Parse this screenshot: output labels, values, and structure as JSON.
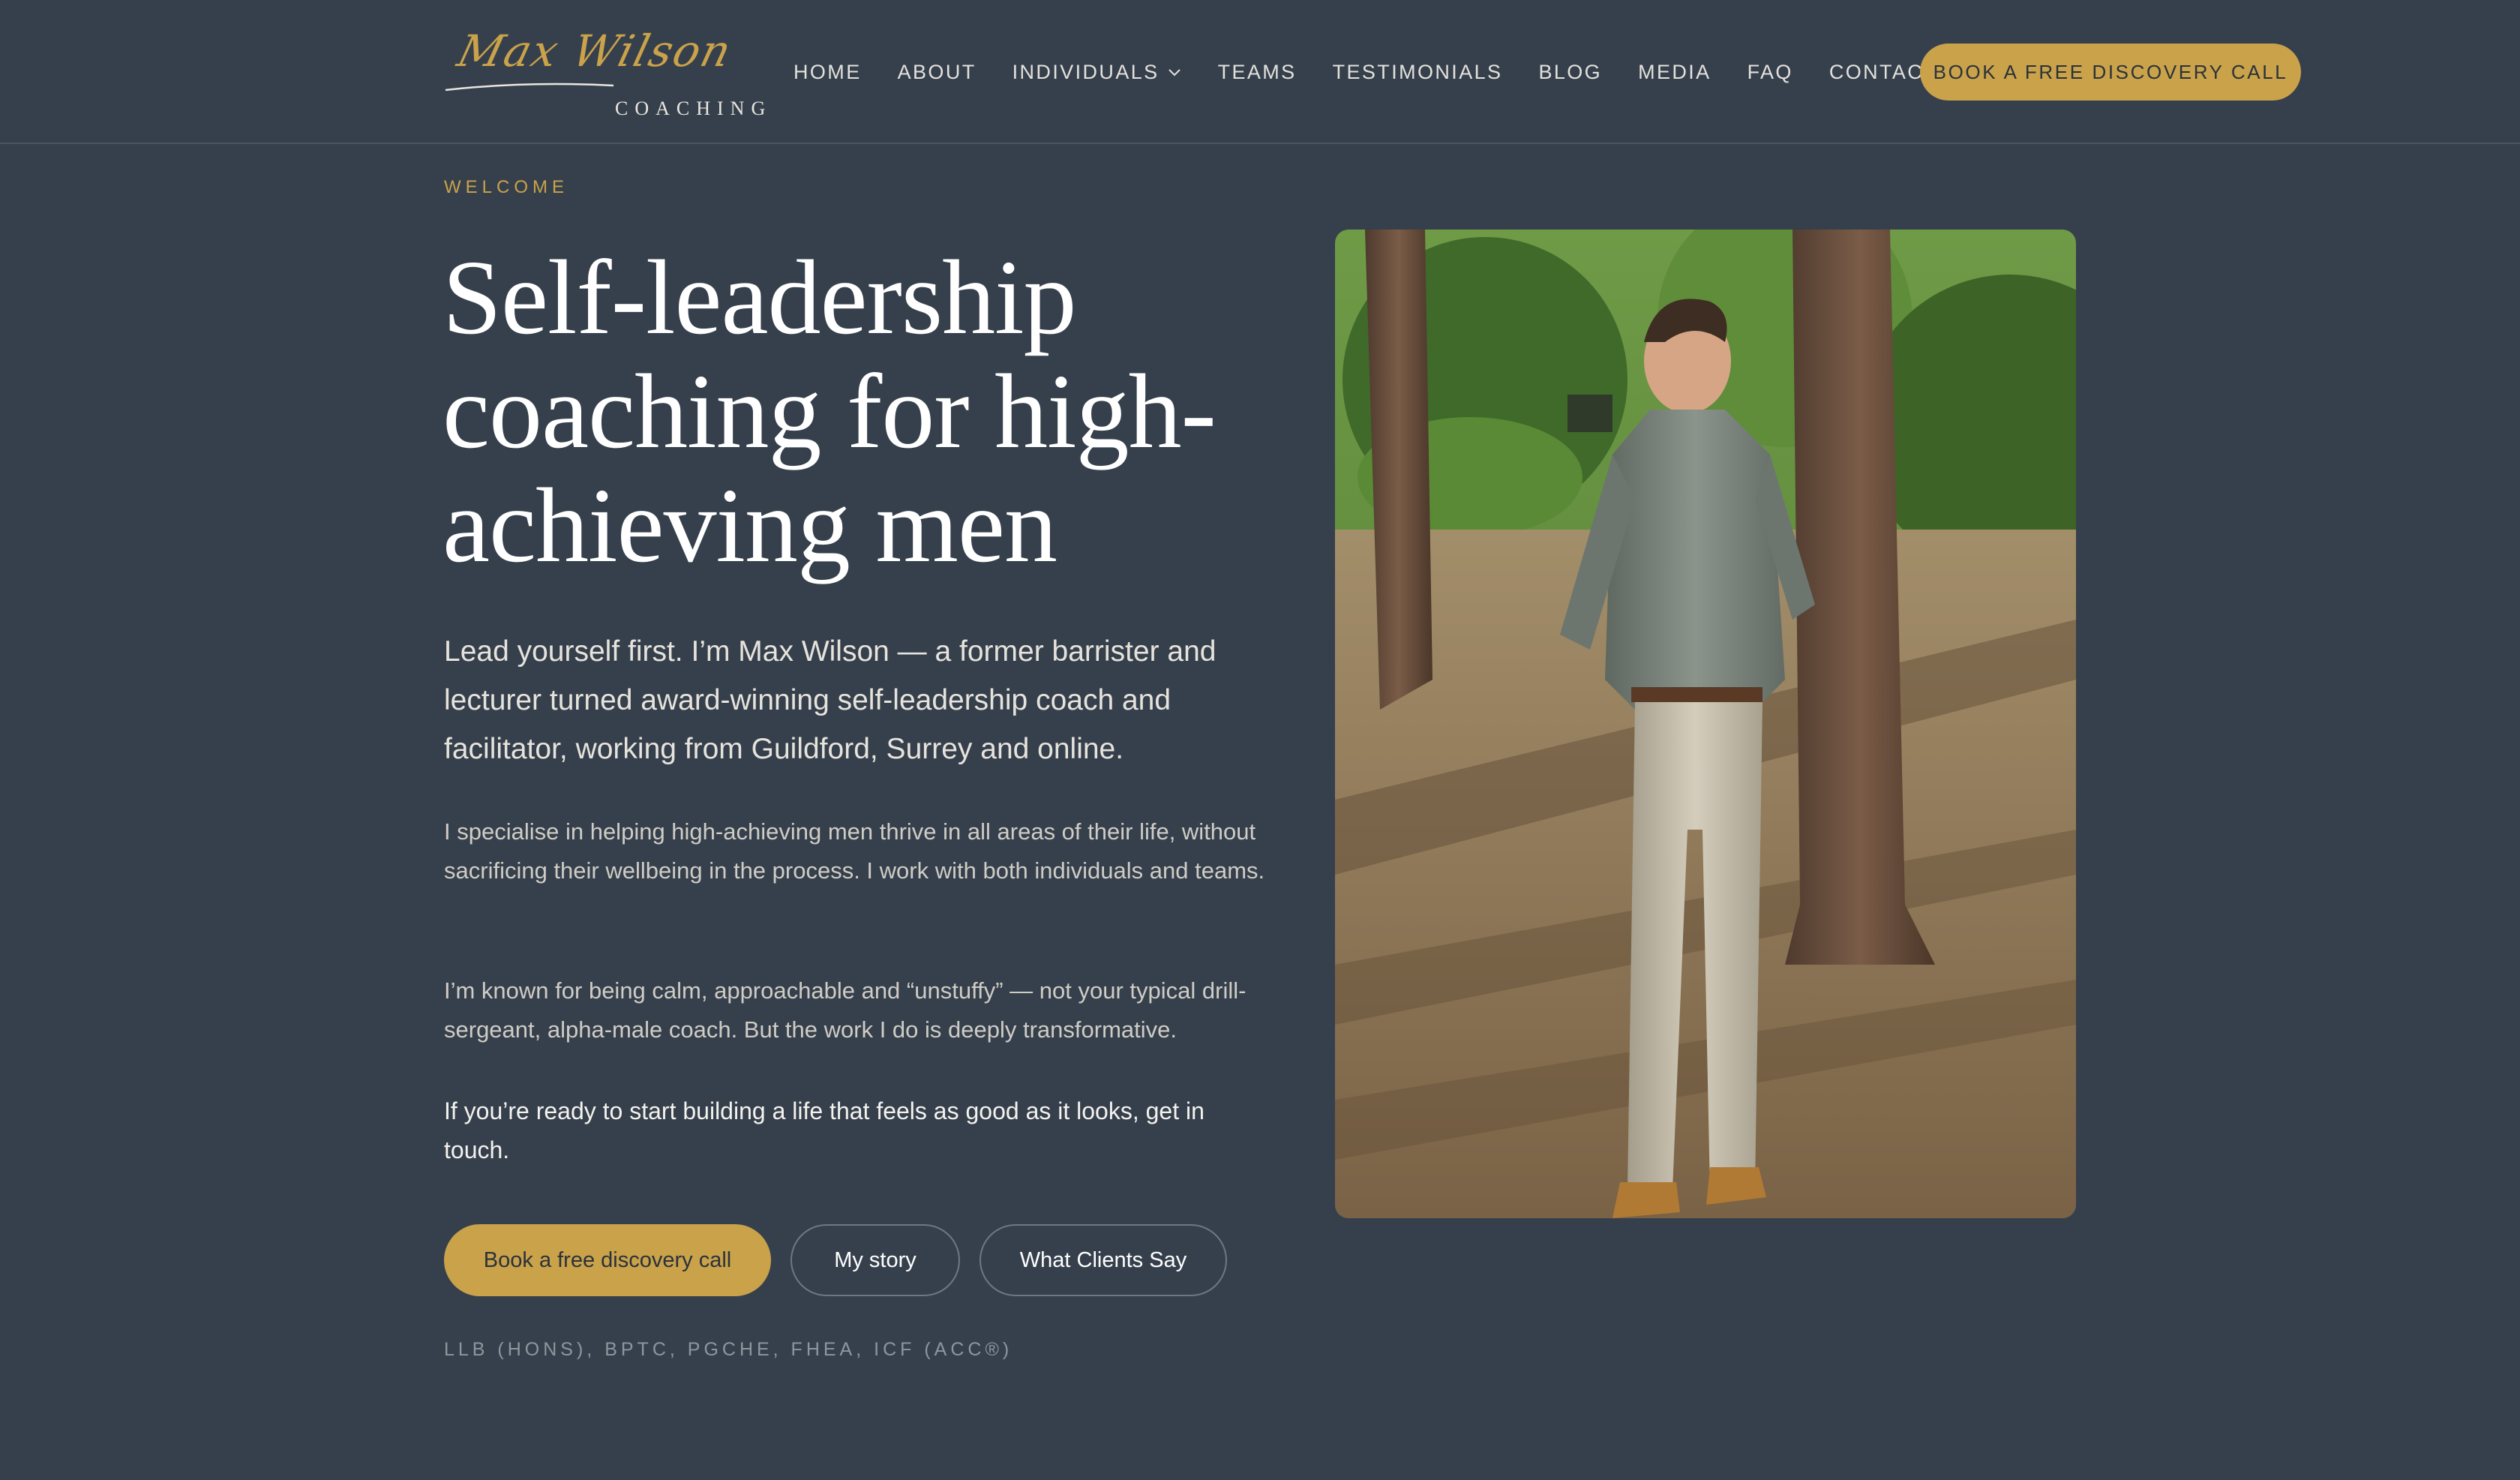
{
  "brand": {
    "script": "Max Wilson",
    "sub": "COACHING"
  },
  "nav": {
    "items": [
      {
        "label": "HOME"
      },
      {
        "label": "ABOUT"
      },
      {
        "label": "INDIVIDUALS",
        "icon": "chevron-down-icon"
      },
      {
        "label": "TEAMS"
      },
      {
        "label": "TESTIMONIALS"
      },
      {
        "label": "BLOG"
      },
      {
        "label": "MEDIA"
      },
      {
        "label": "FAQ"
      },
      {
        "label": "CONTACT"
      }
    ],
    "cta": "BOOK A FREE DISCOVERY CALL"
  },
  "hero": {
    "eyebrow": "WELCOME",
    "title_lines": [
      "Self-leadership",
      "coaching for high-",
      "achieving men"
    ],
    "lead": "Lead yourself first. I’m Max Wilson — a former barrister and lecturer turned award-winning self-leadership coach and facilitator, working from Guildford, Surrey and online.",
    "para1": "I specialise in helping high-achieving men thrive in all areas of their life, without sacrificing their wellbeing in the process. I work with both individuals and teams.",
    "para2": "I’m known for being calm, approachable and “unstuffy” — not your typical drill-sergeant, alpha-male coach. But the work I do is deeply transformative.",
    "para3": "If you’re ready to start building a life that feels as good as it looks, get in touch.",
    "buttons": {
      "primary": "Book a free discovery call",
      "story": "My story",
      "clients": "What Clients Say"
    },
    "credentials": "LLB (HONS), BPTC, PGCHE, FHEA, ICF (ACC®)"
  },
  "colors": {
    "background": "#36404c",
    "accent": "#c9a24a",
    "text": "#e9e6df"
  }
}
